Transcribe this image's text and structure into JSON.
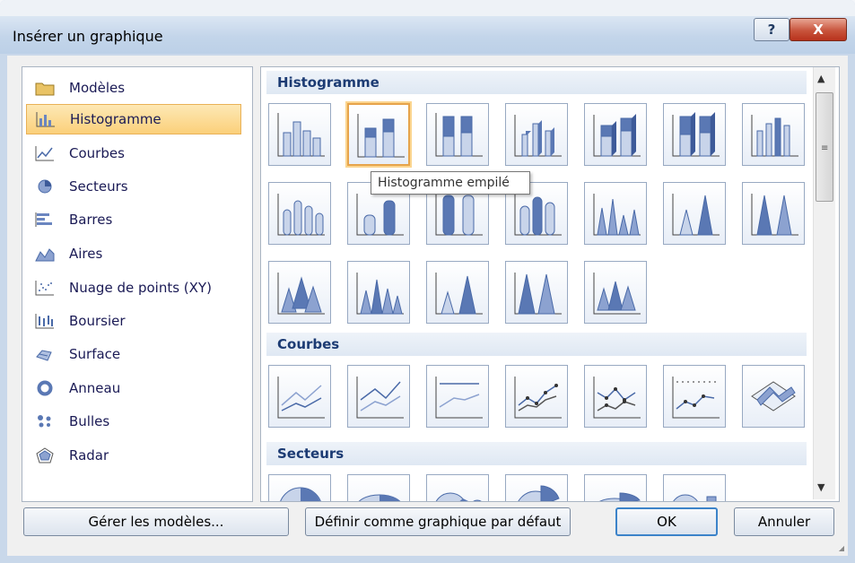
{
  "window": {
    "title": "Insérer un graphique",
    "help_label": "?",
    "close_label": "X"
  },
  "sidebar": {
    "items": [
      {
        "label": "Modèles",
        "icon": "folder-icon"
      },
      {
        "label": "Histogramme",
        "icon": "column-chart-icon",
        "selected": true
      },
      {
        "label": "Courbes",
        "icon": "line-chart-icon"
      },
      {
        "label": "Secteurs",
        "icon": "pie-chart-icon"
      },
      {
        "label": "Barres",
        "icon": "bar-chart-icon"
      },
      {
        "label": "Aires",
        "icon": "area-chart-icon"
      },
      {
        "label": "Nuage de points (XY)",
        "icon": "scatter-chart-icon"
      },
      {
        "label": "Boursier",
        "icon": "stock-chart-icon"
      },
      {
        "label": "Surface",
        "icon": "surface-chart-icon"
      },
      {
        "label": "Anneau",
        "icon": "doughnut-chart-icon"
      },
      {
        "label": "Bulles",
        "icon": "bubble-chart-icon"
      },
      {
        "label": "Radar",
        "icon": "radar-chart-icon"
      }
    ]
  },
  "gallery": {
    "sections": [
      "Histogramme",
      "Courbes",
      "Secteurs"
    ],
    "tooltip": "Histogramme empilé",
    "scroll_up": "▲",
    "scroll_down": "▼",
    "scroll_grip": "≡"
  },
  "footer": {
    "manage_label": "Gérer les modèles...",
    "default_label": "Définir comme graphique par défaut",
    "ok_label": "OK",
    "cancel_label": "Annuler"
  },
  "colors": {
    "accent": "#1c3b73",
    "selection": "#fbd07a",
    "bar_fill": "#5a78b4"
  }
}
